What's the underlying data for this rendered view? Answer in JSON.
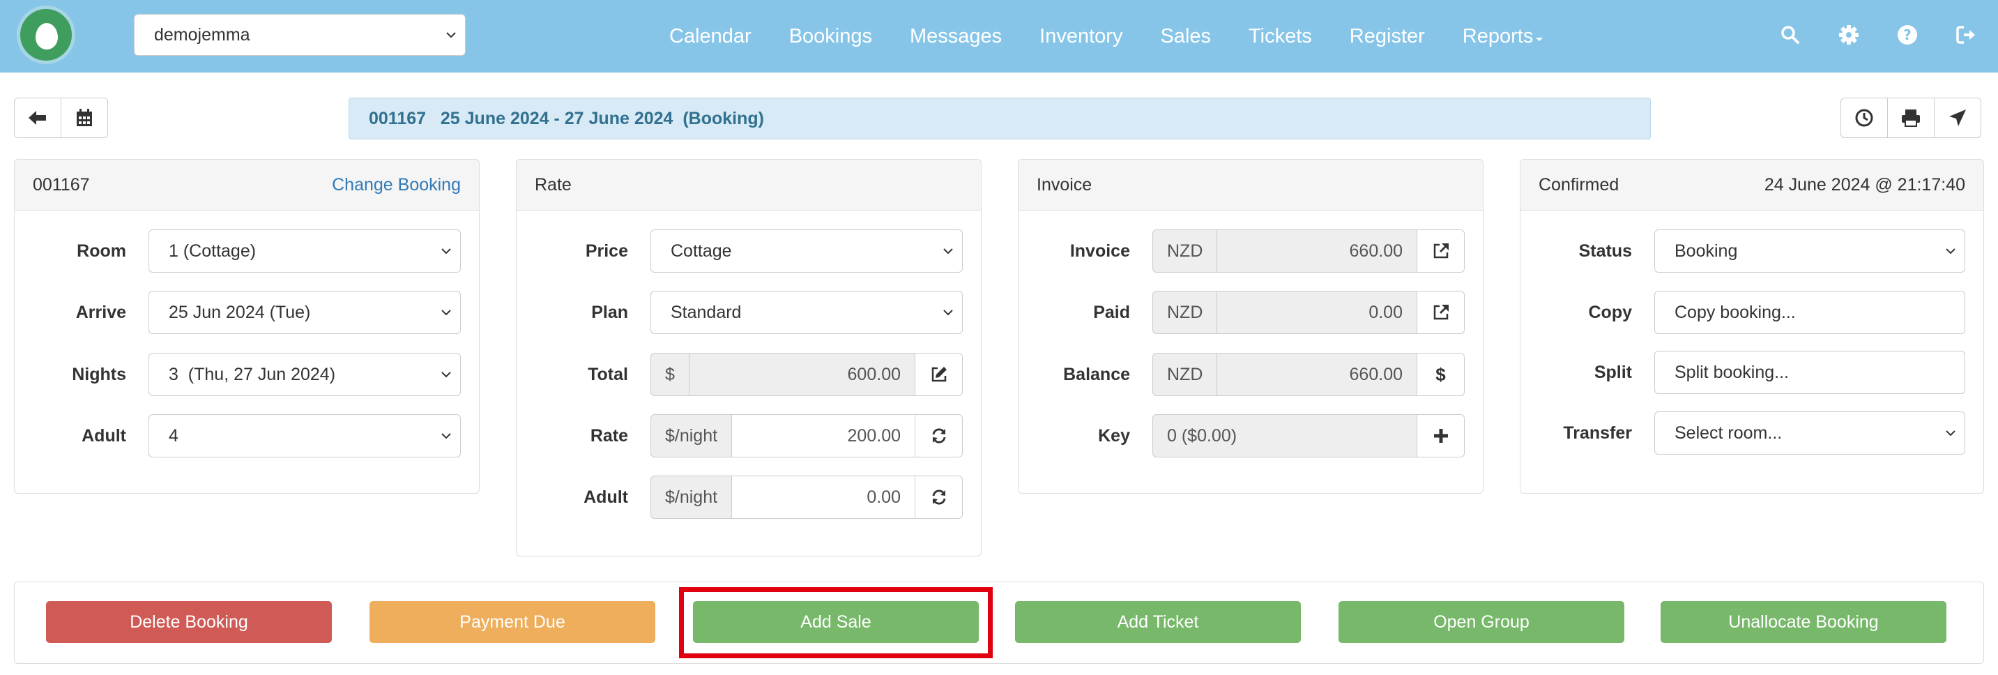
{
  "navbar": {
    "account_select": "demojemma",
    "links": [
      "Calendar",
      "Bookings",
      "Messages",
      "Inventory",
      "Sales",
      "Tickets",
      "Register",
      "Reports"
    ],
    "icons": [
      "search-icon",
      "gear-icon",
      "help-icon",
      "sign-out-icon"
    ]
  },
  "header": {
    "booking_id": "001167",
    "dates": "25 June 2024 - 27 June 2024",
    "type": "(Booking)"
  },
  "booking_panel": {
    "id": "001167",
    "change_link": "Change Booking",
    "fields": [
      {
        "label": "Room",
        "value": "1 (Cottage)"
      },
      {
        "label": "Arrive",
        "value": "25 Jun 2024 (Tue)"
      },
      {
        "label": "Nights",
        "value": "3  (Thu, 27 Jun 2024)"
      },
      {
        "label": "Adult",
        "value": "4"
      }
    ]
  },
  "rate_panel": {
    "title": "Rate",
    "price_label": "Price",
    "price_value": "Cottage",
    "plan_label": "Plan",
    "plan_value": "Standard",
    "total_label": "Total",
    "total_unit": "$",
    "total_value": "600.00",
    "rate_label": "Rate",
    "rate_unit": "$/night",
    "rate_value": "200.00",
    "adult_label": "Adult",
    "adult_unit": "$/night",
    "adult_value": "0.00"
  },
  "invoice_panel": {
    "title": "Invoice",
    "invoice_label": "Invoice",
    "invoice_currency": "NZD",
    "invoice_value": "660.00",
    "paid_label": "Paid",
    "paid_currency": "NZD",
    "paid_value": "0.00",
    "balance_label": "Balance",
    "balance_currency": "NZD",
    "balance_value": "660.00",
    "key_label": "Key",
    "key_value": "0 ($0.00)"
  },
  "status_panel": {
    "title": "Confirmed",
    "timestamp": "24 June 2024 @ 21:17:40",
    "status_label": "Status",
    "status_value": "Booking",
    "copy_label": "Copy",
    "copy_value": "Copy booking...",
    "split_label": "Split",
    "split_value": "Split booking...",
    "transfer_label": "Transfer",
    "transfer_value": "Select room..."
  },
  "actions": {
    "delete": "Delete Booking",
    "payment_due": "Payment Due",
    "add_sale": "Add Sale",
    "add_ticket": "Add Ticket",
    "open_group": "Open Group",
    "unallocate": "Unallocate Booking"
  },
  "colors": {
    "navbar": "#86c5e8",
    "danger": "#d05b56",
    "warning": "#eeae5c",
    "success": "#77b86a",
    "highlight": "#e0000f",
    "link": "#337ab7"
  }
}
